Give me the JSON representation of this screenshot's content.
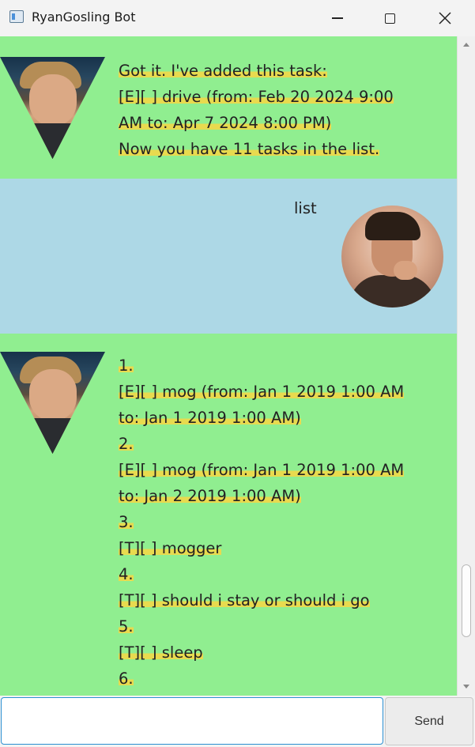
{
  "window": {
    "title": "RyanGosling Bot",
    "icon": "java-app-icon"
  },
  "messages": [
    {
      "sender": "bot",
      "lines": [
        "Got it. I've added this task:",
        "[E][ ] drive (from: Feb 20 2024 9:00",
        "AM to: Apr 7 2024 8:00 PM)",
        "Now you have 11 tasks in the list."
      ]
    },
    {
      "sender": "user",
      "text": "list"
    },
    {
      "sender": "bot",
      "lines": [
        "1.",
        "[E][ ] mog (from: Jan 1 2019 1:00 AM",
        "to: Jan 1 2019 1:00 AM)",
        "2.",
        "[E][ ] mog (from: Jan 1 2019 1:00 AM",
        "to: Jan 2 2019 1:00 AM)",
        "3.",
        "[T][ ] mogger",
        "4.",
        "[T][ ] should i stay or should i go",
        "5.",
        "[T][ ] sleep",
        "6."
      ]
    }
  ],
  "input": {
    "value": "",
    "placeholder": ""
  },
  "send_label": "Send",
  "colors": {
    "bot_bubble": "#90ee90",
    "user_bubble": "#add8e6",
    "text_highlight": "#e8da4f",
    "input_focus": "#2b8fd1"
  }
}
